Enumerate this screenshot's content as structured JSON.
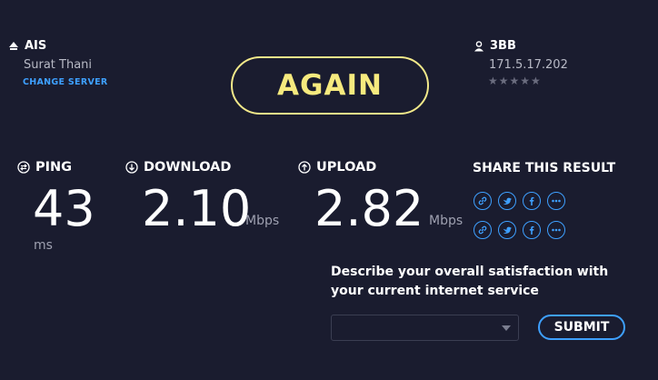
{
  "colors": {
    "background": "#1a1c2f",
    "accent": "#3ea0ff",
    "again": "#f6ea7e",
    "muted": "#9ea0b0"
  },
  "server": {
    "isp": "AIS",
    "location": "Surat Thani",
    "change_label": "CHANGE SERVER",
    "icon": "network-icon"
  },
  "client": {
    "provider": "3BB",
    "ip": "171.5.17.202",
    "rating_stars": 5,
    "rating_value": 0,
    "icon": "user-icon"
  },
  "again_label": "AGAIN",
  "metrics": {
    "ping": {
      "label": "PING",
      "value": "43",
      "unit": "ms"
    },
    "download": {
      "label": "DOWNLOAD",
      "value": "2.10",
      "unit": "Mbps"
    },
    "upload": {
      "label": "UPLOAD",
      "value": "2.82",
      "unit": "Mbps"
    }
  },
  "share": {
    "title": "SHARE THIS RESULT",
    "icons": [
      "link-icon",
      "twitter-icon",
      "facebook-icon",
      "more-icon"
    ]
  },
  "survey": {
    "question": "Describe your overall satisfaction with your current internet service",
    "selected": "",
    "submit_label": "SUBMIT"
  }
}
